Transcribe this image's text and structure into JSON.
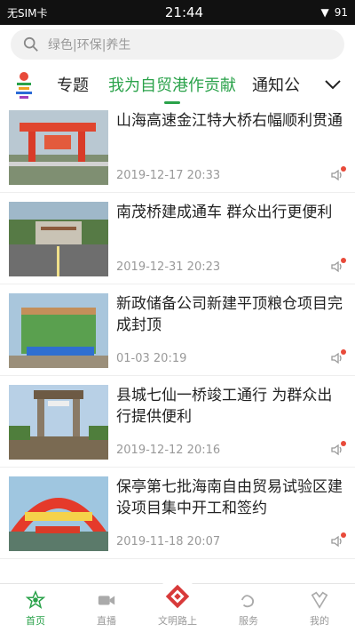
{
  "status": {
    "left": "无SIM卡",
    "time": "21:44",
    "battery": "91"
  },
  "search": {
    "placeholder": "绿色|环保|养生"
  },
  "tabs": {
    "items": [
      {
        "label": "专题"
      },
      {
        "label": "我为自贸港作贡献",
        "active": true
      },
      {
        "label": "通知公"
      }
    ]
  },
  "news": [
    {
      "title": "山海高速金江特大桥右幅顺利贯通",
      "time": "2019-12-17 20:33"
    },
    {
      "title": "南茂桥建成通车 群众出行更便利",
      "time": "2019-12-31 20:23"
    },
    {
      "title": "新政储备公司新建平顶粮仓项目完成封顶",
      "time": "01-03 20:19"
    },
    {
      "title": "县城七仙一桥竣工通行 为群众出行提供便利",
      "time": "2019-12-12 20:16"
    },
    {
      "title": "保亭第七批海南自由贸易试验区建设项目集中开工和签约",
      "time": "2019-11-18 20:07"
    }
  ],
  "bottomnav": [
    {
      "label": "首页",
      "icon": "home-icon",
      "active": true
    },
    {
      "label": "直播",
      "icon": "live-icon"
    },
    {
      "label": "文明路上",
      "icon": "civilization-icon"
    },
    {
      "label": "服务",
      "icon": "service-icon"
    },
    {
      "label": "我的",
      "icon": "profile-icon"
    }
  ],
  "colors": {
    "accent": "#2aa24a",
    "dot": "#e84a3a"
  }
}
